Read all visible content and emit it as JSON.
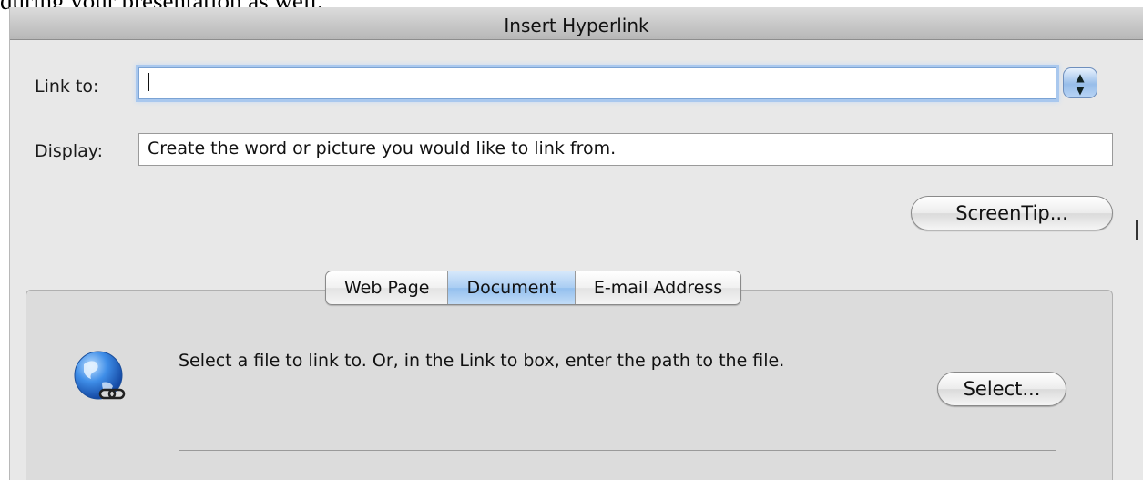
{
  "page_text": "during your presentation as well.",
  "dialog": {
    "title": "Insert Hyperlink"
  },
  "link_to": {
    "label": "Link to:",
    "value": ""
  },
  "display": {
    "label": "Display:",
    "value": "Create the word or picture you would like to link from."
  },
  "buttons": {
    "screentip": "ScreenTip...",
    "select": "Select..."
  },
  "tabs": [
    {
      "label": "Web Page",
      "active": false
    },
    {
      "label": "Document",
      "active": true
    },
    {
      "label": "E-mail Address",
      "active": false
    }
  ],
  "document_tab": {
    "description": "Select a file to link to. Or, in the Link to box, enter the path to the file."
  },
  "icons": {
    "stepper": "up-down-arrows-icon",
    "globe": "globe-link-icon"
  },
  "colors": {
    "active_tab": "#a9cdf3",
    "focus_ring": "#a9c8ee",
    "stepper": "#97bde9"
  }
}
